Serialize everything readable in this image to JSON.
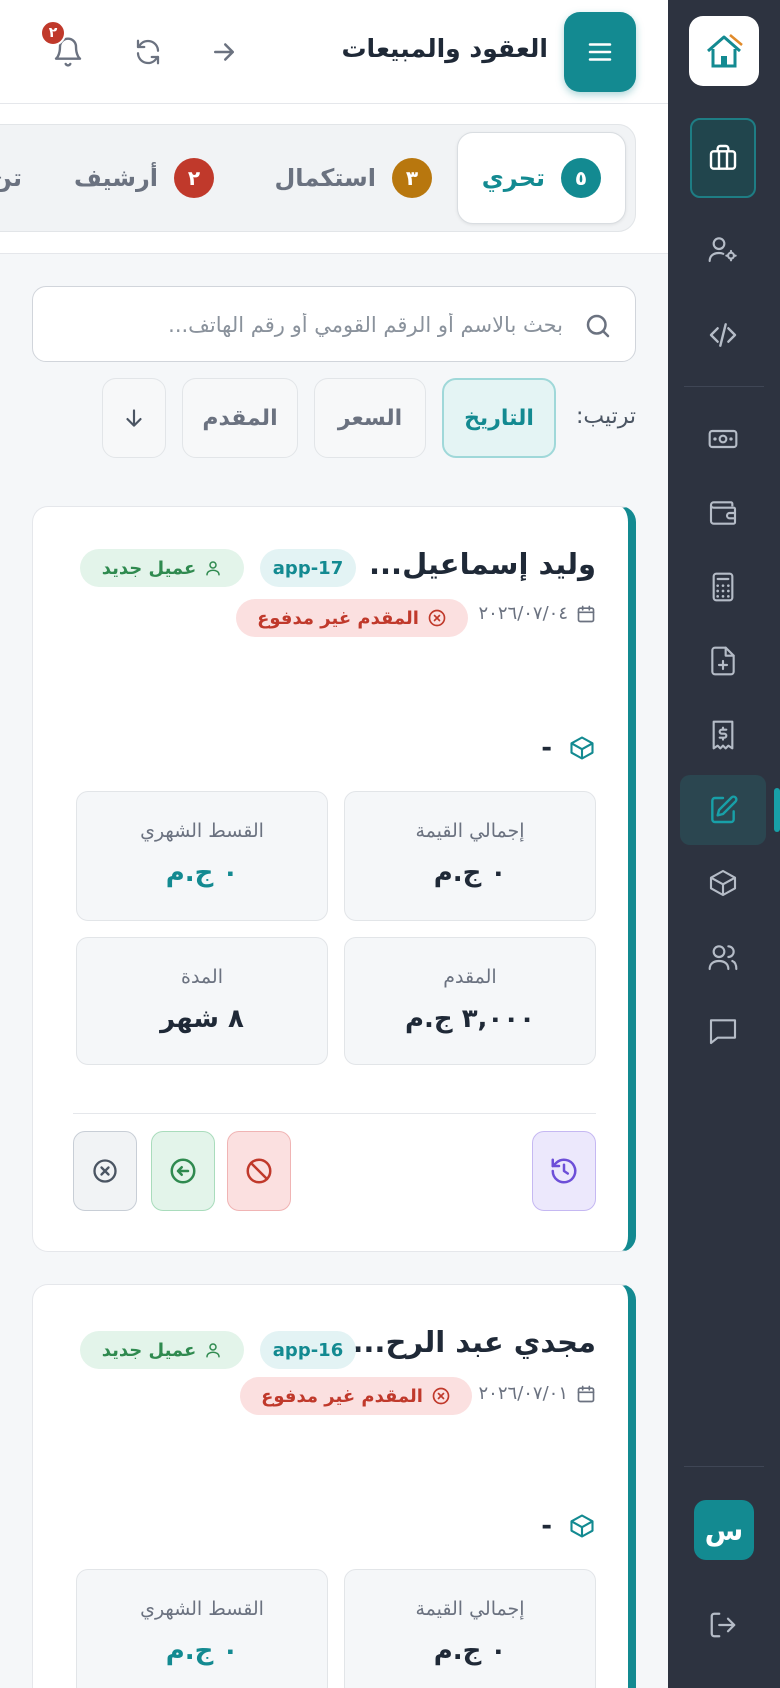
{
  "header": {
    "title": "العقود والمبيعات",
    "notification_count": "٢"
  },
  "tabs": [
    {
      "label": "تحري",
      "count": "٥",
      "color": "#138a91",
      "active": true
    },
    {
      "label": "استكمال",
      "count": "٣",
      "color": "#b8770e",
      "active": false
    },
    {
      "label": "أرشيف",
      "count": "٢",
      "color": "#c0392b",
      "active": false
    },
    {
      "label": "تن",
      "active": false
    }
  ],
  "search": {
    "placeholder": "بحث بالاسم أو الرقم القومي أو رقم الهاتف...",
    "value": ""
  },
  "sort": {
    "label": "ترتيب:",
    "options": [
      "التاريخ",
      "السعر",
      "المقدم"
    ],
    "selected": "التاريخ",
    "direction": "descending"
  },
  "cards": [
    {
      "name": "وليد إسماعيل...",
      "app_id": "app-17",
      "customer_tag": "عميل جديد",
      "date": "٢٠٢٦/٠٧/٠٤",
      "payment_status": "المقدم غير مدفوع",
      "product": "-",
      "total_label": "إجمالي القيمة",
      "total_value": "٠ ج.م",
      "installment_label": "القسط الشهري",
      "installment_value": "٠ ج.م",
      "down_label": "المقدم",
      "down_value": "٣,٠٠٠ ج.م",
      "duration_label": "المدة",
      "duration_value": "٨ شهر"
    },
    {
      "name": "مجدي عبد الرح...",
      "app_id": "app-16",
      "customer_tag": "عميل جديد",
      "date": "٢٠٢٦/٠٧/٠١",
      "payment_status": "المقدم غير مدفوع",
      "product": "-",
      "total_label": "إجمالي القيمة",
      "total_value": "٠ ج.م",
      "installment_label": "القسط الشهري",
      "installment_value": "٠ ج.م"
    }
  ],
  "sidebar": {
    "avatar_initial": "س",
    "items": [
      "briefcase-icon",
      "user-settings-icon",
      "code-icon",
      "cash-icon",
      "wallet-icon",
      "calculator-icon",
      "file-plus-icon",
      "receipt-dollar-icon",
      "edit-document-icon",
      "box-icon",
      "users-icon",
      "chat-icon",
      "logout-icon"
    ]
  },
  "colors": {
    "accent": "#138a91",
    "sidebar_bg": "#2d3340",
    "danger": "#c0392b",
    "warning": "#b8770e",
    "success": "#2f8a4f"
  }
}
